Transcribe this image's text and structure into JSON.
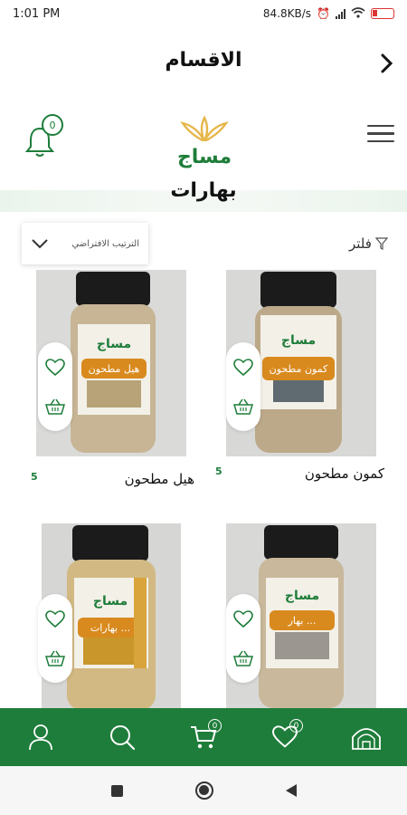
{
  "status_bar": {
    "time": "1:01 PM",
    "network_speed": "84.8KB/s",
    "battery_level": "11"
  },
  "header": {
    "title": "الاقسام"
  },
  "notifications": {
    "count": "0"
  },
  "brand": {
    "logo_text": "مساج",
    "accent_color": "#1e7d3a",
    "logo_gold": "#e6b64a"
  },
  "section": {
    "title": "بهارات"
  },
  "sort": {
    "label": "الترتيب الافتراضي"
  },
  "filter": {
    "label": "فلتر"
  },
  "products": [
    {
      "name": "كمون مطحون",
      "price": "5",
      "jar_label": "كمون مطحون"
    },
    {
      "name": "هيل مطحون",
      "price": "5",
      "jar_label": "هيل مطحون"
    },
    {
      "name": "",
      "price": "",
      "jar_label": "بهار ... "
    },
    {
      "name": "",
      "price": "",
      "jar_label": "بهارات ... "
    }
  ],
  "bottom_nav": {
    "cart_count": "0",
    "favorites_count": "0",
    "items": [
      "home-icon",
      "heart-icon",
      "cart-icon",
      "search-icon",
      "user-icon"
    ]
  }
}
